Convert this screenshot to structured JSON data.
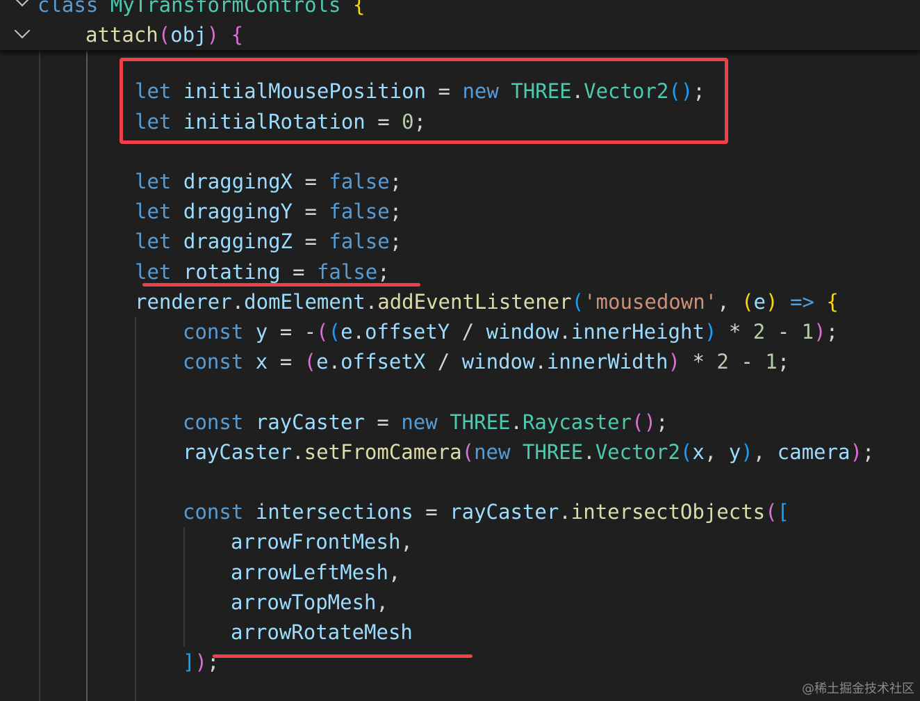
{
  "sticky": {
    "line1": {
      "kw": "class",
      "name": "MyTransformControls",
      "brace": "{"
    },
    "line2": {
      "fn": "attach",
      "open": "(",
      "param": "obj",
      "close": ")",
      "brace": "{"
    }
  },
  "code": {
    "l1": {
      "kw": "let",
      "name": "initialMousePosition",
      "eq": "=",
      "new": "new",
      "cls": "THREE",
      "dot": ".",
      "ctor": "Vector2",
      "parens": "()",
      "semi": ";"
    },
    "l2": {
      "kw": "let",
      "name": "initialRotation",
      "eq": "=",
      "num": "0",
      "semi": ";"
    },
    "l3": {
      "kw": "let",
      "name": "draggingX",
      "eq": "=",
      "val": "false",
      "semi": ";"
    },
    "l4": {
      "kw": "let",
      "name": "draggingY",
      "eq": "=",
      "val": "false",
      "semi": ";"
    },
    "l5": {
      "kw": "let",
      "name": "draggingZ",
      "eq": "=",
      "val": "false",
      "semi": ";"
    },
    "l6": {
      "kw": "let",
      "name": "rotating",
      "eq": "=",
      "val": "false",
      "semi": ";"
    },
    "l7": {
      "obj": "renderer",
      "dot1": ".",
      "prop": "domElement",
      "dot2": ".",
      "fn": "addEventListener",
      "open": "(",
      "str": "'mousedown'",
      "comma": ",",
      "popen": "(",
      "param": "e",
      "pclose": ")",
      "arrow": "=>",
      "brace": "{"
    },
    "l8": {
      "kw": "const",
      "name": "y",
      "eq": "=",
      "neg": "-",
      "o1": "(",
      "o2": "(",
      "e": "e",
      "dot1": ".",
      "prop": "offsetY",
      "div": "/",
      "win": "window",
      "dot2": ".",
      "prop2": "innerHeight",
      "c2": ")",
      "mul": "*",
      "two": "2",
      "minus": "-",
      "one": "1",
      "c1": ")",
      "semi": ";"
    },
    "l9": {
      "kw": "const",
      "name": "x",
      "eq": "=",
      "o1": "(",
      "e": "e",
      "dot1": ".",
      "prop": "offsetX",
      "div": "/",
      "win": "window",
      "dot2": ".",
      "prop2": "innerWidth",
      "c1": ")",
      "mul": "*",
      "two": "2",
      "minus": "-",
      "one": "1",
      "semi": ";"
    },
    "l10": {
      "kw": "const",
      "name": "rayCaster",
      "eq": "=",
      "new": "new",
      "cls": "THREE",
      "dot": ".",
      "ctor": "Raycaster",
      "parens": "()",
      "semi": ";"
    },
    "l11": {
      "obj": "rayCaster",
      "dot": ".",
      "fn": "setFromCamera",
      "open": "(",
      "new": "new",
      "cls": "THREE",
      "dot2": ".",
      "ctor": "Vector2",
      "o2": "(",
      "x": "x",
      "comma1": ",",
      "y": "y",
      "c2": ")",
      "comma2": ",",
      "cam": "camera",
      "close": ")",
      "semi": ";"
    },
    "l12": {
      "kw": "const",
      "name": "intersections",
      "eq": "=",
      "obj": "rayCaster",
      "dot": ".",
      "fn": "intersectObjects",
      "open": "(",
      "bracket": "["
    },
    "l13": {
      "name": "arrowFrontMesh",
      "comma": ","
    },
    "l14": {
      "name": "arrowLeftMesh",
      "comma": ","
    },
    "l15": {
      "name": "arrowTopMesh",
      "comma": ","
    },
    "l16": {
      "name": "arrowRotateMesh"
    },
    "l17": {
      "bracket": "]",
      "close": ")",
      "semi": ";"
    }
  },
  "watermark": "@稀土掘金技术社区",
  "colors": {
    "background": "#1f1f1f",
    "keyword": "#569cd6",
    "variable": "#9cdcfe",
    "class": "#4ec9b0",
    "function": "#dcdcaa",
    "number": "#b5cea8",
    "string": "#ce9178",
    "annotation": "#f0414b"
  }
}
